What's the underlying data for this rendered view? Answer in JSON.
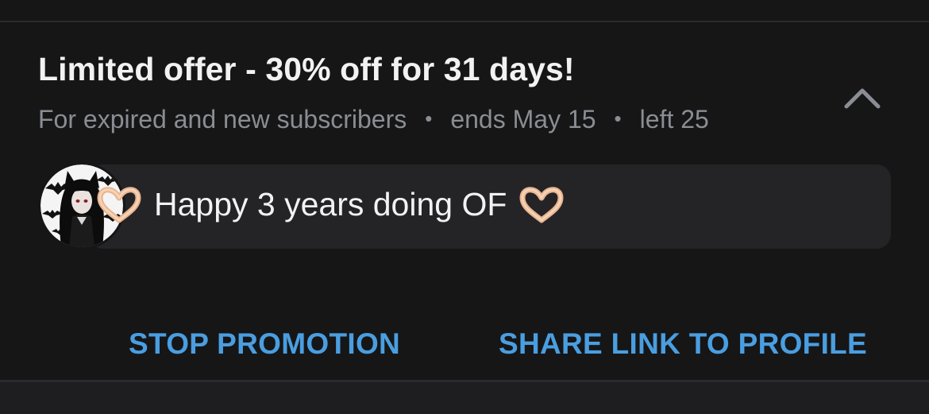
{
  "promo": {
    "title": "Limited offer - 30% off for 31 days!",
    "audience": "For expired and new subscribers",
    "separator": "•",
    "ends": "ends May 15",
    "left": "left 25"
  },
  "message": {
    "text": "Happy 3 years doing OF",
    "emoji_icon": "heart-hands-icon"
  },
  "actions": {
    "stop_label": "STOP PROMOTION",
    "share_label": "SHARE LINK TO PROFILE"
  },
  "colors": {
    "background": "#161617",
    "bubble": "#242427",
    "title": "#f2f2f2",
    "meta": "#8a8d93",
    "accent": "#4a9ee0"
  }
}
